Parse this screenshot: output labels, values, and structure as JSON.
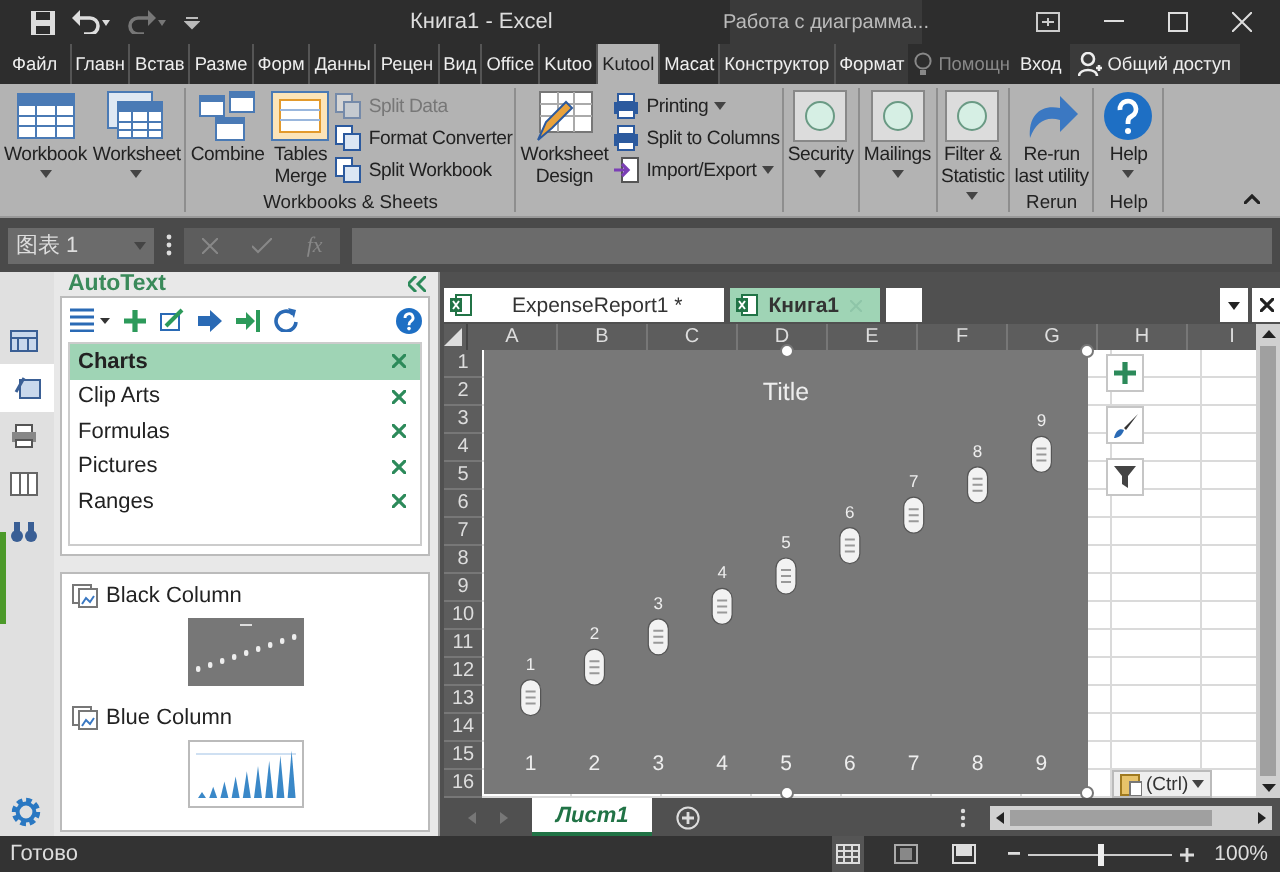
{
  "window": {
    "title": "Книга1 - Excel",
    "context_label": "Работа с диаграмма..."
  },
  "menu_tabs": [
    {
      "label": "Файл",
      "selected": false,
      "kind": "file"
    },
    {
      "label": "Главн",
      "selected": false,
      "kind": "normal"
    },
    {
      "label": "Встав",
      "selected": false,
      "kind": "normal"
    },
    {
      "label": "Разме",
      "selected": false,
      "kind": "normal"
    },
    {
      "label": "Форм",
      "selected": false,
      "kind": "normal"
    },
    {
      "label": "Данны",
      "selected": false,
      "kind": "normal"
    },
    {
      "label": "Рецен",
      "selected": false,
      "kind": "normal"
    },
    {
      "label": "Вид",
      "selected": false,
      "kind": "normal"
    },
    {
      "label": "Office",
      "selected": false,
      "kind": "normal"
    },
    {
      "label": "Kutoo",
      "selected": false,
      "kind": "normal"
    },
    {
      "label": "Kutool",
      "selected": true,
      "kind": "normal"
    },
    {
      "label": "Macat",
      "selected": false,
      "kind": "normal"
    },
    {
      "label": "Конструктор",
      "selected": false,
      "kind": "contextual"
    },
    {
      "label": "Формат",
      "selected": false,
      "kind": "contextual"
    }
  ],
  "tell_me": "Помощн",
  "sign_in": "Вход",
  "share": "Общий доступ",
  "ribbon_groups": [
    {
      "items": [
        {
          "kind": "large",
          "label": "Workbook",
          "dropdown": true
        },
        {
          "kind": "large",
          "label": "Worksheet",
          "dropdown": true
        }
      ]
    },
    {
      "label": "Workbooks & Sheets",
      "items": [
        {
          "kind": "large",
          "label": "Combine",
          "dropdown": false
        },
        {
          "kind": "large",
          "label": "Tables\nMerge",
          "dropdown": false
        },
        {
          "kind": "stack",
          "items": [
            {
              "label": "Split Data",
              "dropdown": false,
              "disabled": true
            },
            {
              "label": "Format Converter",
              "dropdown": false,
              "disabled": false
            },
            {
              "label": "Split Workbook",
              "dropdown": false,
              "disabled": false
            }
          ]
        }
      ]
    },
    {
      "items": [
        {
          "kind": "large",
          "label": "Worksheet\nDesign",
          "dropdown": false
        },
        {
          "kind": "stack",
          "items": [
            {
              "label": "Printing",
              "dropdown": true,
              "disabled": false
            },
            {
              "label": "Split to Columns",
              "dropdown": false,
              "disabled": false
            },
            {
              "label": "Import/Export",
              "dropdown": true,
              "disabled": false
            }
          ]
        }
      ]
    },
    {
      "items": [
        {
          "kind": "large",
          "label": "Security",
          "dropdown": true
        }
      ]
    },
    {
      "items": [
        {
          "kind": "large",
          "label": "Mailings",
          "dropdown": true
        }
      ]
    },
    {
      "items": [
        {
          "kind": "large",
          "label": "Filter &\nStatistic",
          "dropdown": true
        }
      ]
    },
    {
      "label": "Rerun",
      "items": [
        {
          "kind": "large",
          "label": "Re-run\nlast utility",
          "dropdown": false
        }
      ]
    },
    {
      "label": "Help",
      "items": [
        {
          "kind": "large",
          "label": "Help",
          "dropdown": true
        }
      ]
    }
  ],
  "formula_bar": {
    "name_box": "图表 1",
    "function_label": "fx"
  },
  "sidebar_tabs": [
    {
      "selected": false
    },
    {
      "selected": true
    },
    {
      "selected": false
    },
    {
      "selected": false
    },
    {
      "selected": false
    }
  ],
  "autotext": {
    "title": "AutoText",
    "categories": [
      {
        "label": "Charts",
        "selected": true
      },
      {
        "label": "Clip Arts",
        "selected": false
      },
      {
        "label": "Formulas",
        "selected": false
      },
      {
        "label": "Pictures",
        "selected": false
      },
      {
        "label": "Ranges",
        "selected": false
      }
    ],
    "entries": [
      {
        "label": "Black Column",
        "kind": "dark"
      },
      {
        "label": "Blue Column",
        "kind": "blue"
      }
    ]
  },
  "workbook_tabs": [
    {
      "label": "ExpenseReport1 *",
      "selected": false
    },
    {
      "label": "Книга1",
      "selected": true
    }
  ],
  "sheet": {
    "columns": [
      "A",
      "B",
      "C",
      "D",
      "E",
      "F",
      "G",
      "H",
      "I"
    ],
    "rows": [
      "1",
      "2",
      "3",
      "4",
      "5",
      "6",
      "7",
      "8",
      "9",
      "10",
      "11",
      "12",
      "13",
      "14",
      "15",
      "16"
    ],
    "chart": {
      "chart_data": {
        "type": "scatter",
        "title": "Title",
        "x": [
          1,
          2,
          3,
          4,
          5,
          6,
          7,
          8,
          9
        ],
        "series": [
          {
            "color": "#f2f2f2",
            "values": [
              1,
              2,
              3,
              4,
              5,
              6,
              7,
              8,
              9
            ]
          }
        ],
        "xlim": [
          0.27,
          9.73
        ],
        "xticks": [
          1,
          2,
          3,
          4,
          5,
          6,
          7,
          8,
          9
        ],
        "data_labels": true
      }
    },
    "paste_options": "(Ctrl)"
  },
  "sheet_tabs": [
    {
      "label": "Лист1",
      "selected": true
    }
  ],
  "status_bar": {
    "text": "Готово",
    "zoom": "100%",
    "zoom_slider": {
      "level": 0.5
    }
  }
}
